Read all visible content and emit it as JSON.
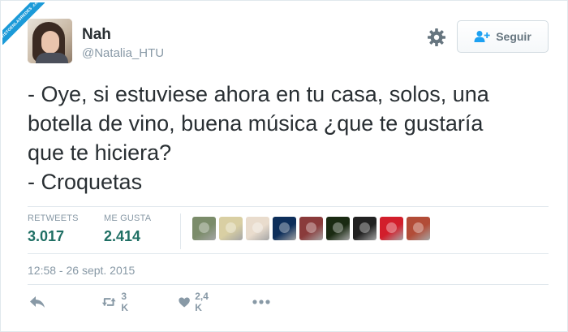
{
  "watermark": {
    "text": "VISTOENLASREDES .com"
  },
  "header": {
    "name": "Nah",
    "handle": "@Natalia_HTU",
    "follow_label": "Seguir"
  },
  "tweet": {
    "lines": [
      "- Oye, si estuviese ahora en tu casa, solos, una",
      "botella de vino, buena música ¿que te gustaría",
      "que te hiciera?",
      "- Croquetas"
    ]
  },
  "stats": {
    "retweets_label": "RETWEETS",
    "retweets_value": "3.017",
    "likes_label": "ME GUSTA",
    "likes_value": "2.414"
  },
  "likers": [
    {
      "name": "liker-avatar",
      "color": "#7b8c6a"
    },
    {
      "name": "liker-avatar",
      "color": "#d9cfa3"
    },
    {
      "name": "liker-avatar",
      "color": "#e9dccd"
    },
    {
      "name": "liker-avatar",
      "color": "#0d2e5a"
    },
    {
      "name": "liker-avatar",
      "color": "#8a3b3b"
    },
    {
      "name": "liker-avatar",
      "color": "#1a2a12"
    },
    {
      "name": "liker-avatar",
      "color": "#222222"
    },
    {
      "name": "liker-avatar",
      "color": "#d21e2b"
    },
    {
      "name": "liker-avatar",
      "color": "#b24c37"
    }
  ],
  "timestamp": "12:58 - 26 sept. 2015",
  "actions": {
    "retweet_count": "3 K",
    "like_count": "2,4 K"
  },
  "colors": {
    "text": "#292f33",
    "muted": "#8899a6",
    "count": "#1f6f64",
    "border": "#e1e8ed"
  }
}
